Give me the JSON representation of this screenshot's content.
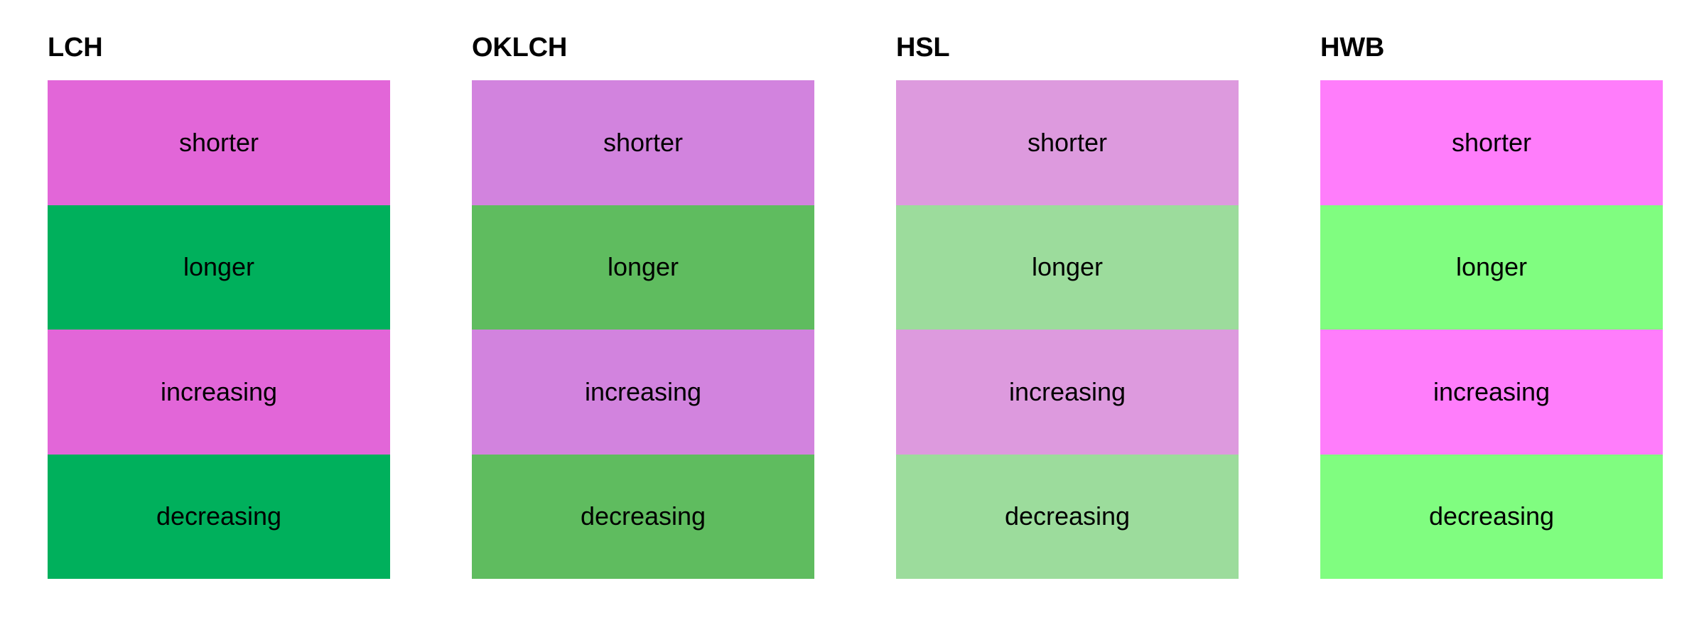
{
  "page": {
    "background": "#ffffff"
  },
  "row_labels": [
    "shorter",
    "longer",
    "increasing",
    "decreasing"
  ],
  "columns": [
    {
      "title": "LCH",
      "swatches": [
        {
          "label": "shorter",
          "color": "#e266d8"
        },
        {
          "label": "longer",
          "color": "#00b05c"
        },
        {
          "label": "increasing",
          "color": "#e266d8"
        },
        {
          "label": "decreasing",
          "color": "#00b05c"
        }
      ]
    },
    {
      "title": "OKLCH",
      "swatches": [
        {
          "label": "shorter",
          "color": "#d283de"
        },
        {
          "label": "longer",
          "color": "#5fbc5f"
        },
        {
          "label": "increasing",
          "color": "#d283de"
        },
        {
          "label": "decreasing",
          "color": "#5fbc5f"
        }
      ]
    },
    {
      "title": "HSL",
      "swatches": [
        {
          "label": "shorter",
          "color": "#dd9ade"
        },
        {
          "label": "longer",
          "color": "#9cdc9c"
        },
        {
          "label": "increasing",
          "color": "#dd9ade"
        },
        {
          "label": "decreasing",
          "color": "#9cdc9c"
        }
      ]
    },
    {
      "title": "HWB",
      "swatches": [
        {
          "label": "shorter",
          "color": "#ff7dfb"
        },
        {
          "label": "longer",
          "color": "#80fd80"
        },
        {
          "label": "increasing",
          "color": "#ff7dfb"
        },
        {
          "label": "decreasing",
          "color": "#80fd80"
        }
      ]
    }
  ],
  "text_color": "#000000"
}
